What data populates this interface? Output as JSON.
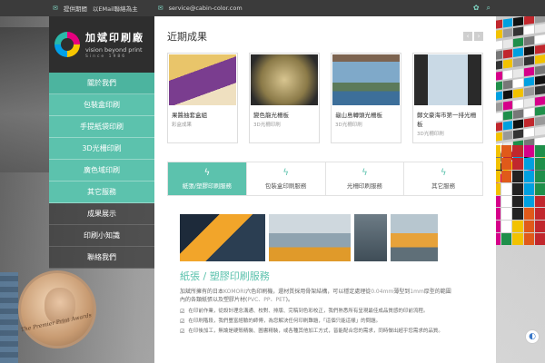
{
  "topbar": {
    "phone_icon": "envelope-icon",
    "text_a": "提供期間",
    "text_b": "以EMail聯絡為主",
    "email": "service@cabin-color.com",
    "right_icons": [
      "wechat-icon",
      "search-icon"
    ]
  },
  "logo": {
    "title": "加斌印刷廠",
    "subtitle": "vision beyond print",
    "since": "Since 1986"
  },
  "menu": [
    {
      "label": "關於我們"
    },
    {
      "label": "包裝盒印刷"
    },
    {
      "label": "手提紙袋印刷"
    },
    {
      "label": "3D光柵印刷"
    },
    {
      "label": "廣色域印刷"
    },
    {
      "label": "其它服務"
    },
    {
      "label": "成果展示"
    },
    {
      "label": "印刷小知識"
    },
    {
      "label": "聯絡我們"
    }
  ],
  "award": {
    "text": "The Premier Print Awards"
  },
  "recent": {
    "title": "近期成果",
    "prev": "‹",
    "next": "›",
    "products": [
      {
        "name": "果醬抽套盒組",
        "category": "彩盒成果"
      },
      {
        "name": "變色龍光柵板",
        "category": "3D光柵印刷"
      },
      {
        "name": "龜山島轉頭光柵板",
        "category": "3D光柵印刷"
      },
      {
        "name": "鄭文豪海市第一排光柵板",
        "category": "3D光柵印刷"
      }
    ]
  },
  "tabs": [
    {
      "label": "紙張/塑膠印刷服務",
      "active": true
    },
    {
      "label": "包裝盒印刷服務",
      "active": false
    },
    {
      "label": "光柵印刷服務",
      "active": false
    },
    {
      "label": "其它服務",
      "active": false
    }
  ],
  "service": {
    "title": "紙張 / 塑膠印刷服務",
    "desc_a": "加斌所擁有的日本",
    "desc_hl_a": "KOMORI",
    "desc_b": "六色印刷機，還材質採用骨架結構，可以穩定處理從",
    "desc_hl_b": "0.04mm",
    "desc_c": "薄型到",
    "desc_hl_c": "1mm",
    "desc_d": "厚型的範圍內的各類紙張以及塑膠片材(",
    "desc_hl_d": "PVC、PP、PET",
    "desc_e": ")。",
    "bullets": [
      "在印前作業，從設計理念溝通、校對、排版、完稿到色彩校正，我們熟悉所有呈現最佳成品質感的印前流程。",
      "在印刷階段，我們豐富經驗的師傅，為您解決任何印刷難題，「這個只能這樣」的問題。",
      "在印後加工，無論是硬殼精裝、圖書精裝，或各種其他加工方式，皆能配合您的需求，同時做出超乎您需求的品質。"
    ]
  },
  "chat": {
    "icon": "chat-icon",
    "glyph": "◐"
  }
}
